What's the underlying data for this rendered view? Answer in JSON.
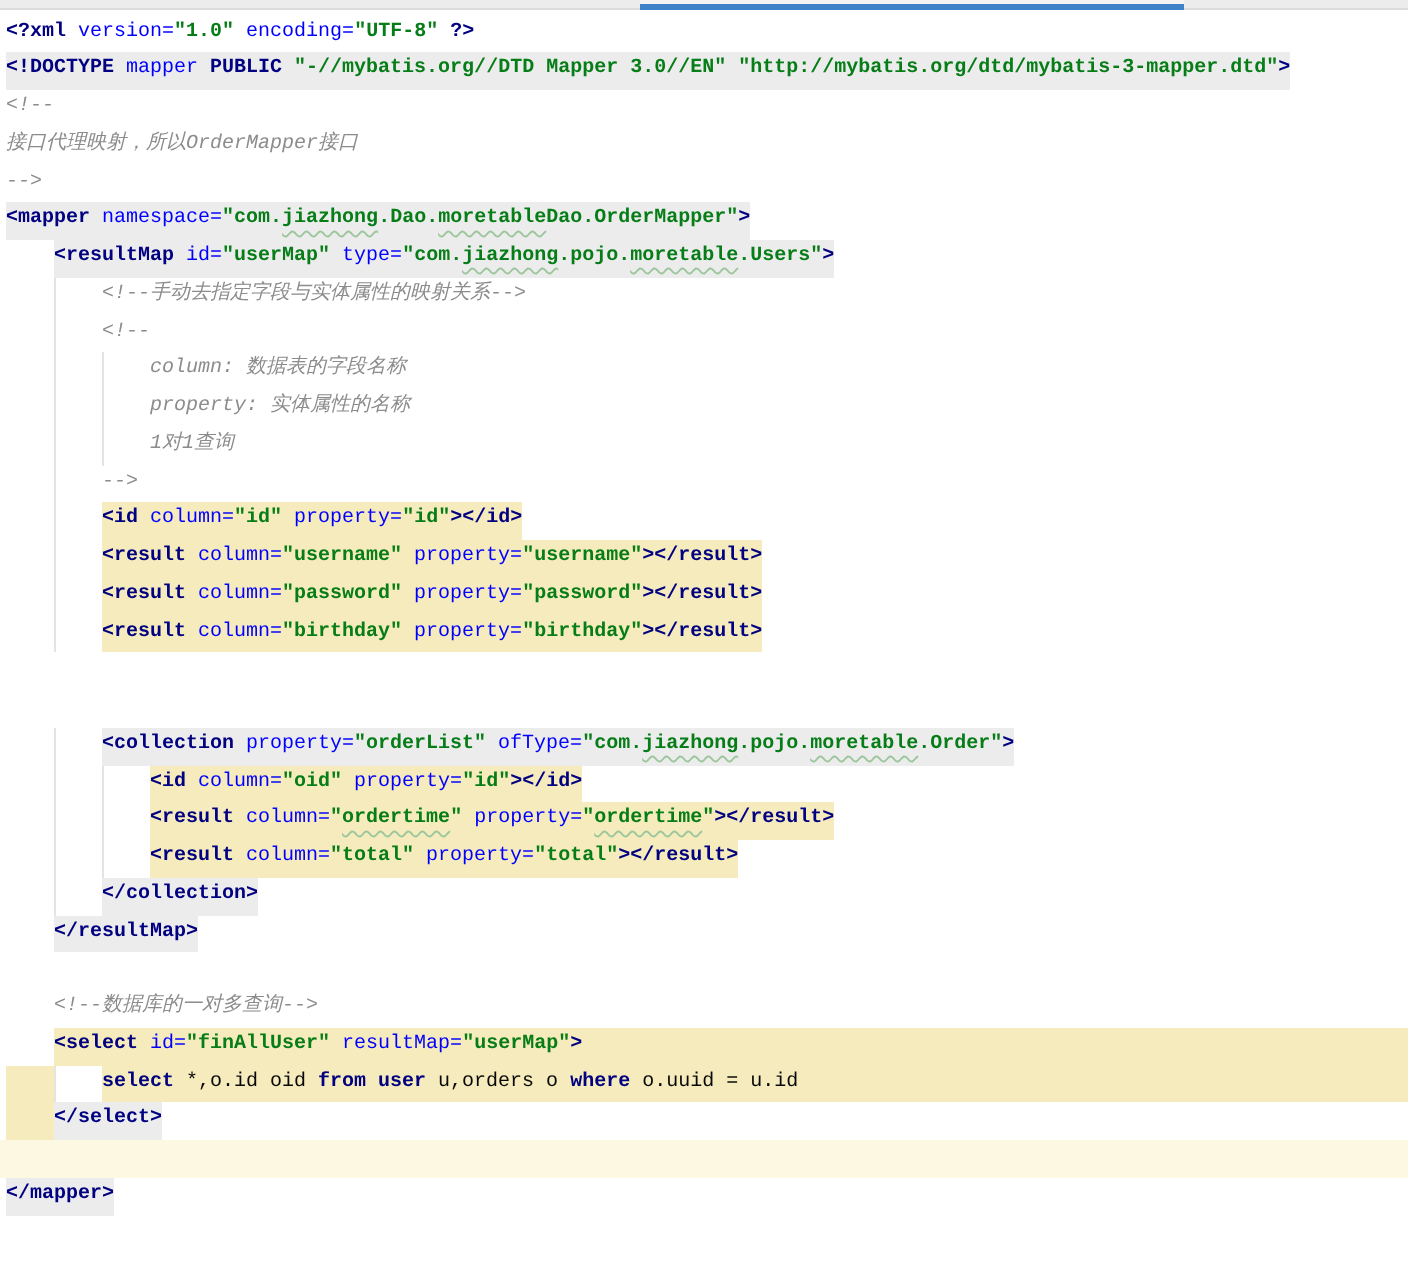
{
  "tabs": [
    {
      "selected": false
    },
    {
      "selected": true
    },
    {
      "selected": false
    }
  ],
  "lines": [
    {
      "kind": "plain",
      "tokens": [
        {
          "kind": "tag",
          "text": "<?xml"
        },
        {
          "kind": "attr",
          "text": " version="
        },
        {
          "kind": "value",
          "text": "\"1.0\""
        },
        {
          "kind": "attr",
          "text": " encoding="
        },
        {
          "kind": "value",
          "text": "\"UTF-8\""
        },
        {
          "kind": "tag",
          "text": " ?>"
        }
      ]
    },
    {
      "kind": "match",
      "tokens": [
        {
          "kind": "tag",
          "text": "<!DOCTYPE "
        },
        {
          "kind": "attr",
          "text": "mapper"
        },
        {
          "kind": "tag",
          "text": " PUBLIC "
        },
        {
          "kind": "value",
          "text": "\"-//mybatis.org//DTD Mapper 3.0//EN\" "
        },
        {
          "kind": "value",
          "text": "\"http://mybatis.org/dtd/mybatis-3-mapper.dtd\""
        },
        {
          "kind": "tag",
          "text": ">"
        }
      ]
    },
    {
      "kind": "plain",
      "tokens": [
        {
          "kind": "comment",
          "text": "<!--"
        }
      ]
    },
    {
      "kind": "plain",
      "tokens": [
        {
          "kind": "comment",
          "text": "接口代理映射，所以OrderMapper接口"
        }
      ]
    },
    {
      "kind": "plain",
      "tokens": [
        {
          "kind": "comment",
          "text": "-->"
        }
      ]
    },
    {
      "kind": "match",
      "tokens": [
        {
          "kind": "tag",
          "text": "<mapper"
        },
        {
          "kind": "attr",
          "text": " namespace="
        },
        {
          "kind": "value",
          "text": "\"com."
        },
        {
          "kind": "typo",
          "text": "jiazhong"
        },
        {
          "kind": "value",
          "text": ".Dao."
        },
        {
          "kind": "typo",
          "text": "moretable"
        },
        {
          "kind": "value",
          "text": "Dao.OrderMapper\""
        },
        {
          "kind": "tag",
          "text": ">"
        }
      ]
    },
    {
      "kind": "match",
      "tokens": [
        {
          "kind": "tag",
          "text": "    <resultMap"
        },
        {
          "kind": "attr",
          "text": " id="
        },
        {
          "kind": "value",
          "text": "\"userMap\""
        },
        {
          "kind": "attr",
          "text": " type="
        },
        {
          "kind": "value",
          "text": "\"com."
        },
        {
          "kind": "typo",
          "text": "jiazhong"
        },
        {
          "kind": "value",
          "text": ".pojo."
        },
        {
          "kind": "typo",
          "text": "moretable"
        },
        {
          "kind": "value",
          "text": ".Users\""
        },
        {
          "kind": "tag",
          "text": ">"
        }
      ]
    },
    {
      "kind": "plain",
      "tokens": [
        {
          "kind": "comment",
          "text": "        <!--手动去指定字段与实体属性的映射关系-->"
        }
      ]
    },
    {
      "kind": "plain",
      "tokens": [
        {
          "kind": "comment",
          "text": "        <!--"
        }
      ]
    },
    {
      "kind": "plain",
      "tokens": [
        {
          "kind": "comment",
          "text": "            column: 数据表的字段名称"
        }
      ]
    },
    {
      "kind": "plain",
      "tokens": [
        {
          "kind": "comment",
          "text": "            property: 实体属性的名称"
        }
      ]
    },
    {
      "kind": "plain",
      "tokens": [
        {
          "kind": "comment",
          "text": "            1对1查询"
        }
      ]
    },
    {
      "kind": "plain",
      "tokens": [
        {
          "kind": "comment",
          "text": "        -->"
        }
      ]
    },
    {
      "kind": "block",
      "tokens": [
        {
          "kind": "tag",
          "text": "        <id"
        },
        {
          "kind": "attr",
          "text": " column="
        },
        {
          "kind": "value",
          "text": "\"id\""
        },
        {
          "kind": "attr",
          "text": " property="
        },
        {
          "kind": "value",
          "text": "\"id\""
        },
        {
          "kind": "tag",
          "text": "></id>"
        }
      ]
    },
    {
      "kind": "block",
      "tokens": [
        {
          "kind": "tag",
          "text": "        <result"
        },
        {
          "kind": "attr",
          "text": " column="
        },
        {
          "kind": "value",
          "text": "\"username\""
        },
        {
          "kind": "attr",
          "text": " property="
        },
        {
          "kind": "value",
          "text": "\"username\""
        },
        {
          "kind": "tag",
          "text": "></result>"
        }
      ]
    },
    {
      "kind": "block",
      "tokens": [
        {
          "kind": "tag",
          "text": "        <result"
        },
        {
          "kind": "attr",
          "text": " column="
        },
        {
          "kind": "value",
          "text": "\"password\""
        },
        {
          "kind": "attr",
          "text": " property="
        },
        {
          "kind": "value",
          "text": "\"password\""
        },
        {
          "kind": "tag",
          "text": "></result>"
        }
      ]
    },
    {
      "kind": "block",
      "tokens": [
        {
          "kind": "tag",
          "text": "        <result"
        },
        {
          "kind": "attr",
          "text": " column="
        },
        {
          "kind": "value",
          "text": "\"birthday\""
        },
        {
          "kind": "attr",
          "text": " property="
        },
        {
          "kind": "value",
          "text": "\"birthday\""
        },
        {
          "kind": "tag",
          "text": "></result>"
        }
      ]
    },
    {
      "kind": "blank"
    },
    {
      "kind": "blank"
    },
    {
      "kind": "match",
      "tokens": [
        {
          "kind": "tag",
          "text": "        <collection"
        },
        {
          "kind": "attr",
          "text": " property="
        },
        {
          "kind": "value",
          "text": "\"orderList\""
        },
        {
          "kind": "attr",
          "text": " ofType="
        },
        {
          "kind": "value",
          "text": "\"com."
        },
        {
          "kind": "typo",
          "text": "jiazhong"
        },
        {
          "kind": "value",
          "text": ".pojo."
        },
        {
          "kind": "typo",
          "text": "moretable"
        },
        {
          "kind": "value",
          "text": ".Order\""
        },
        {
          "kind": "tag",
          "text": ">"
        }
      ]
    },
    {
      "kind": "block",
      "tokens": [
        {
          "kind": "tag",
          "text": "            <id"
        },
        {
          "kind": "attr",
          "text": " column="
        },
        {
          "kind": "value",
          "text": "\"oid\""
        },
        {
          "kind": "attr",
          "text": " property="
        },
        {
          "kind": "value",
          "text": "\"id\""
        },
        {
          "kind": "tag",
          "text": "></id>"
        }
      ]
    },
    {
      "kind": "block",
      "tokens": [
        {
          "kind": "tag",
          "text": "            <result"
        },
        {
          "kind": "attr",
          "text": " column="
        },
        {
          "kind": "value",
          "text": "\""
        },
        {
          "kind": "typo",
          "text": "ordertime"
        },
        {
          "kind": "value",
          "text": "\""
        },
        {
          "kind": "attr",
          "text": " property="
        },
        {
          "kind": "value",
          "text": "\""
        },
        {
          "kind": "typo",
          "text": "ordertime"
        },
        {
          "kind": "value",
          "text": "\""
        },
        {
          "kind": "tag",
          "text": "></result>"
        }
      ]
    },
    {
      "kind": "block",
      "tokens": [
        {
          "kind": "tag",
          "text": "            <result"
        },
        {
          "kind": "attr",
          "text": " column="
        },
        {
          "kind": "value",
          "text": "\"total\""
        },
        {
          "kind": "attr",
          "text": " property="
        },
        {
          "kind": "value",
          "text": "\"total\""
        },
        {
          "kind": "tag",
          "text": "></result>"
        }
      ]
    },
    {
      "kind": "match",
      "tokens": [
        {
          "kind": "tag",
          "text": "        </collection>"
        }
      ]
    },
    {
      "kind": "match",
      "tokens": [
        {
          "kind": "tag",
          "text": "    </resultMap>"
        }
      ]
    },
    {
      "kind": "blank"
    },
    {
      "kind": "plain",
      "tokens": [
        {
          "kind": "comment",
          "text": "    <!--数据库的一对多查询-->"
        }
      ]
    },
    {
      "kind": "block-row",
      "tokens": [
        {
          "kind": "tag",
          "text": "    <select"
        },
        {
          "kind": "attr",
          "text": " id="
        },
        {
          "kind": "value",
          "text": "\"finAllUser\""
        },
        {
          "kind": "attr",
          "text": " resultMap="
        },
        {
          "kind": "value",
          "text": "\"userMap\""
        },
        {
          "kind": "tag",
          "text": ">"
        }
      ]
    },
    {
      "kind": "block-row-margin",
      "tokens": [
        {
          "kind": "keyword",
          "text": "        select"
        },
        {
          "kind": "text",
          "text": " *,o.id oid "
        },
        {
          "kind": "keyword",
          "text": "from user"
        },
        {
          "kind": "text",
          "text": " u,orders o "
        },
        {
          "kind": "keyword",
          "text": "where"
        },
        {
          "kind": "text",
          "text": " o.uuid = u.id"
        }
      ]
    },
    {
      "kind": "match-margin",
      "tokens": [
        {
          "kind": "tag",
          "text": "    </select>"
        }
      ]
    },
    {
      "kind": "current"
    },
    {
      "kind": "match",
      "tokens": [
        {
          "kind": "tag",
          "text": "</mapper>"
        }
      ]
    }
  ]
}
